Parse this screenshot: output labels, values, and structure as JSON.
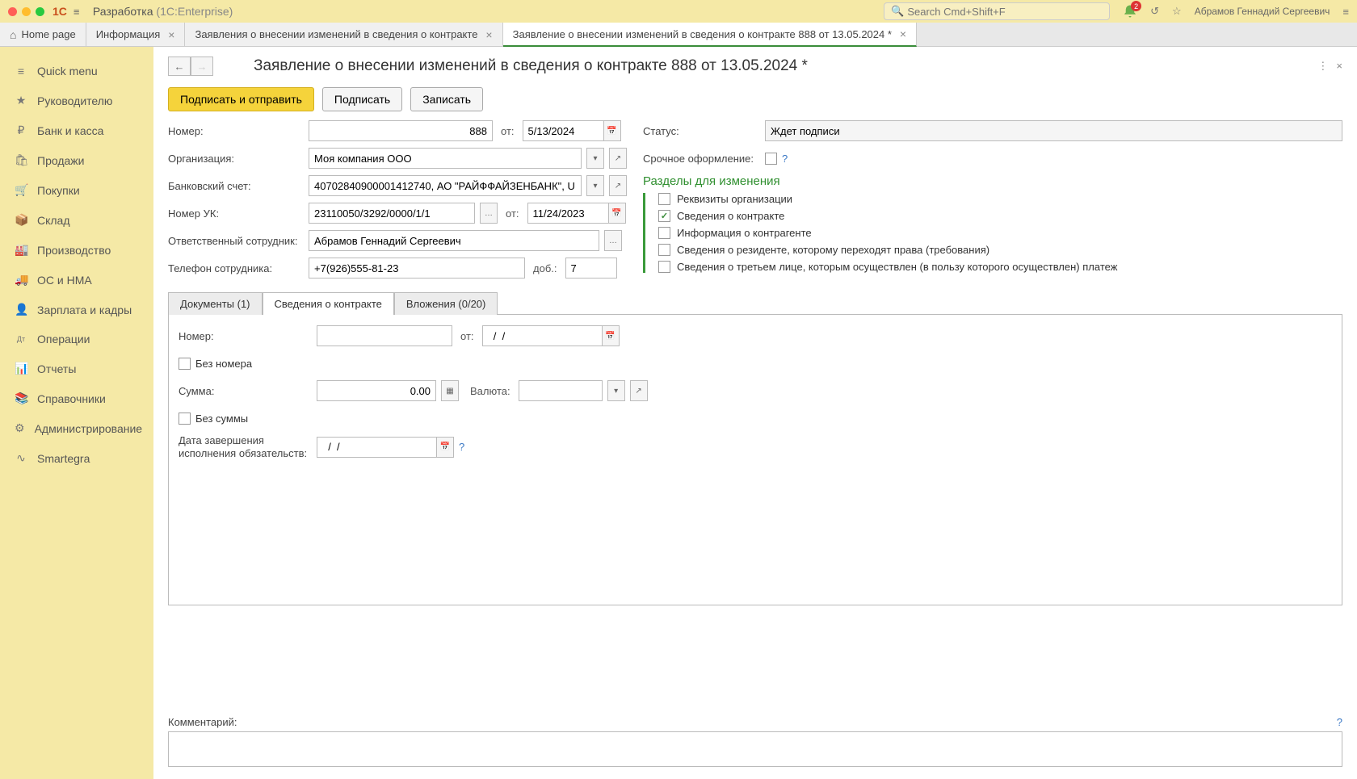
{
  "app": {
    "name": "Разработка",
    "suffix": "(1С:Enterprise)"
  },
  "search": {
    "placeholder": "Search Cmd+Shift+F"
  },
  "notifications": {
    "count": "2"
  },
  "user": {
    "name": "Абрамов Геннадий Сергеевич"
  },
  "tabs": [
    {
      "label": "Home page",
      "home": true
    },
    {
      "label": "Информация",
      "closable": true
    },
    {
      "label": "Заявления о внесении изменений в сведения о контракте",
      "closable": true
    },
    {
      "label": "Заявление о внесении изменений в сведения о контракте 888 от 13.05.2024 *",
      "closable": true,
      "active": true
    }
  ],
  "sidebar": [
    {
      "label": "Quick menu",
      "icon": "≡"
    },
    {
      "label": "Руководителю",
      "icon": "★"
    },
    {
      "label": "Банк и касса",
      "icon": "₽"
    },
    {
      "label": "Продажи",
      "icon": "🛍"
    },
    {
      "label": "Покупки",
      "icon": "🛒"
    },
    {
      "label": "Склад",
      "icon": "📦"
    },
    {
      "label": "Производство",
      "icon": "🏭"
    },
    {
      "label": "ОС и НМА",
      "icon": "🚚"
    },
    {
      "label": "Зарплата и кадры",
      "icon": "👤"
    },
    {
      "label": "Операции",
      "icon": "Дт"
    },
    {
      "label": "Отчеты",
      "icon": "📊"
    },
    {
      "label": "Справочники",
      "icon": "📚"
    },
    {
      "label": "Администрирование",
      "icon": "⚙"
    },
    {
      "label": "Smartegra",
      "icon": "∿"
    }
  ],
  "page": {
    "title": "Заявление о внесении изменений в сведения о контракте 888 от 13.05.2024 *"
  },
  "buttons": {
    "signAndSend": "Подписать и отправить",
    "sign": "Подписать",
    "save": "Записать"
  },
  "fields": {
    "number": {
      "label": "Номер:",
      "value": "888"
    },
    "date_from": {
      "label": "от:",
      "value": "5/13/2024"
    },
    "org": {
      "label": "Организация:",
      "value": "Моя компания ООО"
    },
    "bank": {
      "label": "Банковский счет:",
      "value": "40702840900001412740, АО \"РАЙФФАЙЗЕНБАНК\", U"
    },
    "uk_number": {
      "label": "Номер УК:",
      "value": "23110050/3292/0000/1/1"
    },
    "uk_date": {
      "label": "от:",
      "value": "11/24/2023"
    },
    "responsible": {
      "label": "Ответственный сотрудник:",
      "value": "Абрамов Геннадий Сергеевич"
    },
    "phone": {
      "label": "Телефон сотрудника:",
      "value": "+7(926)555-81-23"
    },
    "ext": {
      "label": "доб.:",
      "value": "7"
    },
    "status": {
      "label": "Статус:",
      "value": "Ждет подписи"
    },
    "urgent": {
      "label": "Срочное оформление:"
    }
  },
  "sections": {
    "title": "Разделы для изменения",
    "items": [
      {
        "label": "Реквизиты организации",
        "checked": false
      },
      {
        "label": "Сведения о контракте",
        "checked": true
      },
      {
        "label": "Информация о контрагенте",
        "checked": false
      },
      {
        "label": "Сведения о резиденте, которому переходят права (требования)",
        "checked": false
      },
      {
        "label": "Сведения о третьем лице, которым осуществлен (в пользу которого осуществлен) платеж",
        "checked": false
      }
    ]
  },
  "innerTabs": {
    "documents": "Документы (1)",
    "contract": "Сведения о контракте",
    "attachments": "Вложения (0/20)"
  },
  "contract": {
    "number": {
      "label": "Номер:",
      "value": ""
    },
    "date": {
      "label": "от:",
      "value": "  /  /"
    },
    "noNumber": "Без номера",
    "amount": {
      "label": "Сумма:",
      "value": "0.00"
    },
    "currency": {
      "label": "Валюта:",
      "value": ""
    },
    "noAmount": "Без суммы",
    "endDate": {
      "label": "Дата завершения исполнения обязательств:",
      "value": "  /  /"
    }
  },
  "comment": {
    "label": "Комментарий:",
    "value": ""
  }
}
